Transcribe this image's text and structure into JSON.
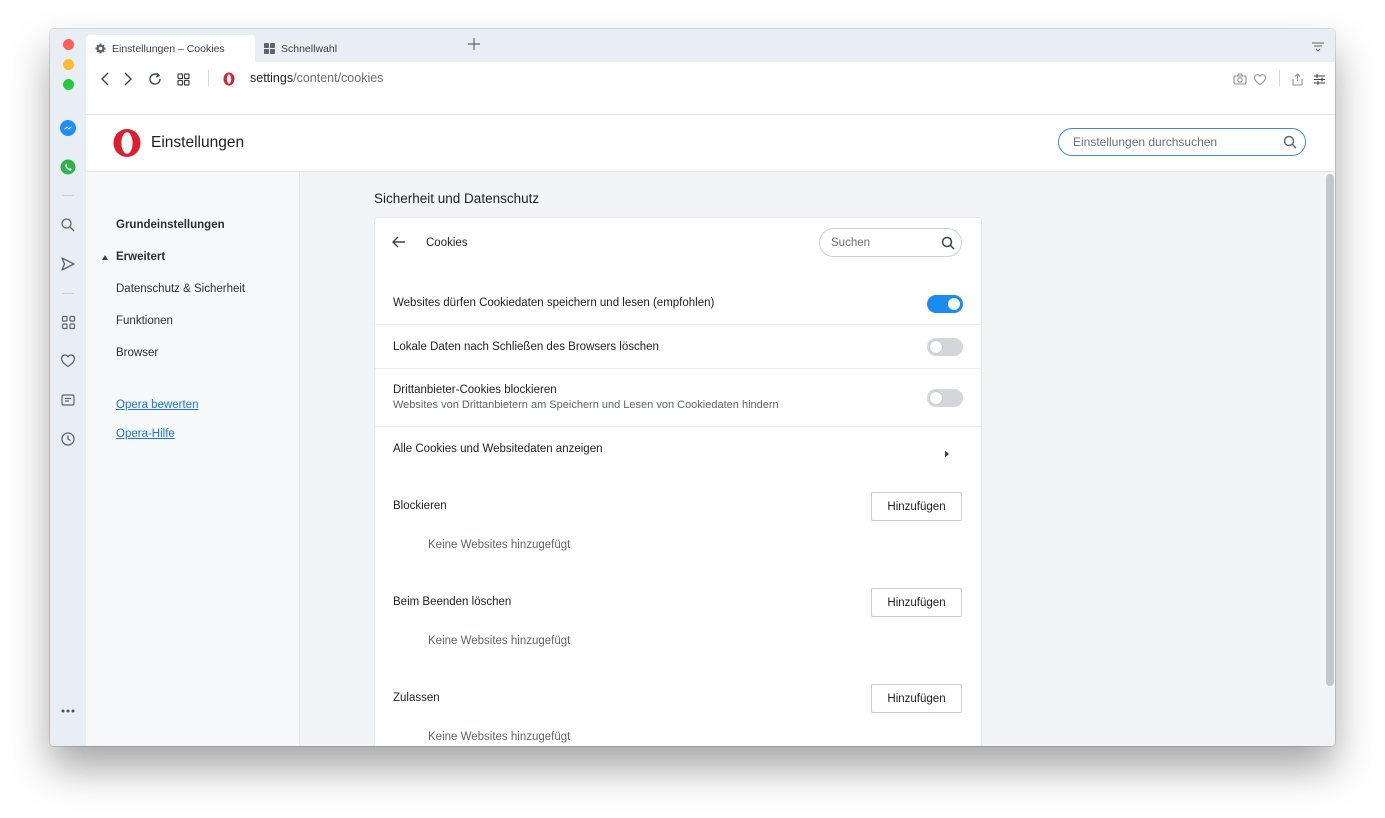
{
  "colors": {
    "accent": "#1a8cf0",
    "link": "#1a73e8",
    "opera_red": "#e01d2e",
    "traffic_red": "#ff5f57",
    "traffic_yellow": "#febc2e",
    "traffic_green": "#28c840"
  },
  "tabs": [
    {
      "label": "Einstellungen – Cookies",
      "icon": "gear-icon",
      "active": true
    },
    {
      "label": "Schnellwahl",
      "icon": "speed-dial-icon",
      "active": false
    }
  ],
  "address": {
    "url_host": "settings",
    "url_path": "/content/cookies"
  },
  "header": {
    "title": "Einstellungen",
    "search_placeholder": "Einstellungen durchsuchen"
  },
  "nav": {
    "basic": "Grundeinstellungen",
    "advanced": "Erweitert",
    "items": [
      "Datenschutz & Sicherheit",
      "Funktionen",
      "Browser"
    ],
    "links": [
      "Opera bewerten",
      "Opera-Hilfe"
    ]
  },
  "main": {
    "section_title": "Sicherheit und Datenschutz",
    "card_title": "Cookies",
    "search_placeholder": "Suchen",
    "rows": [
      {
        "label": "Websites dürfen Cookiedaten speichern und lesen (empfohlen)",
        "toggle": true
      },
      {
        "label": "Lokale Daten nach Schließen des Browsers löschen",
        "toggle": false
      },
      {
        "label": "Drittanbieter-Cookies blockieren",
        "sub": "Websites von Drittanbietern am Speichern und Lesen von Cookiedaten hindern",
        "toggle": false
      },
      {
        "label": "Alle Cookies und Websitedaten anzeigen"
      }
    ],
    "blocks": [
      {
        "title": "Blockieren",
        "button": "Hinzufügen",
        "empty": "Keine Websites hinzugefügt"
      },
      {
        "title": "Beim Beenden löschen",
        "button": "Hinzufügen",
        "empty": "Keine Websites hinzugefügt"
      },
      {
        "title": "Zulassen",
        "button": "Hinzufügen",
        "empty": "Keine Websites hinzugefügt"
      }
    ]
  }
}
